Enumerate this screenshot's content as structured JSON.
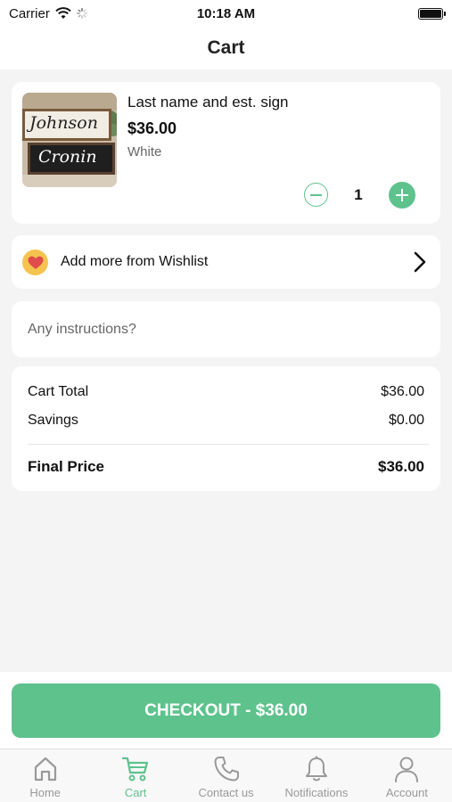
{
  "status_bar": {
    "carrier": "Carrier",
    "time": "10:18 AM"
  },
  "nav": {
    "title": "Cart"
  },
  "cart": {
    "items": [
      {
        "name": "Last name and est. sign",
        "price": "$36.00",
        "variant": "White",
        "quantity": "1",
        "image_text": [
          "Johnson",
          "Cronin"
        ]
      }
    ]
  },
  "wishlist": {
    "label": "Add more from Wishlist"
  },
  "instructions": {
    "placeholder": "Any instructions?",
    "value": ""
  },
  "summary": {
    "cart_total_label": "Cart Total",
    "cart_total_value": "$36.00",
    "savings_label": "Savings",
    "savings_value": "$0.00",
    "final_label": "Final Price",
    "final_value": "$36.00"
  },
  "checkout": {
    "label": "CHECKOUT - $36.00"
  },
  "tabs": [
    {
      "label": "Home",
      "icon": "home-icon"
    },
    {
      "label": "Cart",
      "icon": "cart-icon",
      "active": true
    },
    {
      "label": "Contact us",
      "icon": "phone-icon"
    },
    {
      "label": "Notifications",
      "icon": "bell-icon"
    },
    {
      "label": "Account",
      "icon": "user-icon"
    }
  ],
  "colors": {
    "accent": "#5ec28d",
    "background": "#f4f4f4",
    "card": "#ffffff",
    "wishlist_badge": "#f4c44e",
    "heart": "#e04b4b",
    "tab_inactive": "#999999"
  }
}
